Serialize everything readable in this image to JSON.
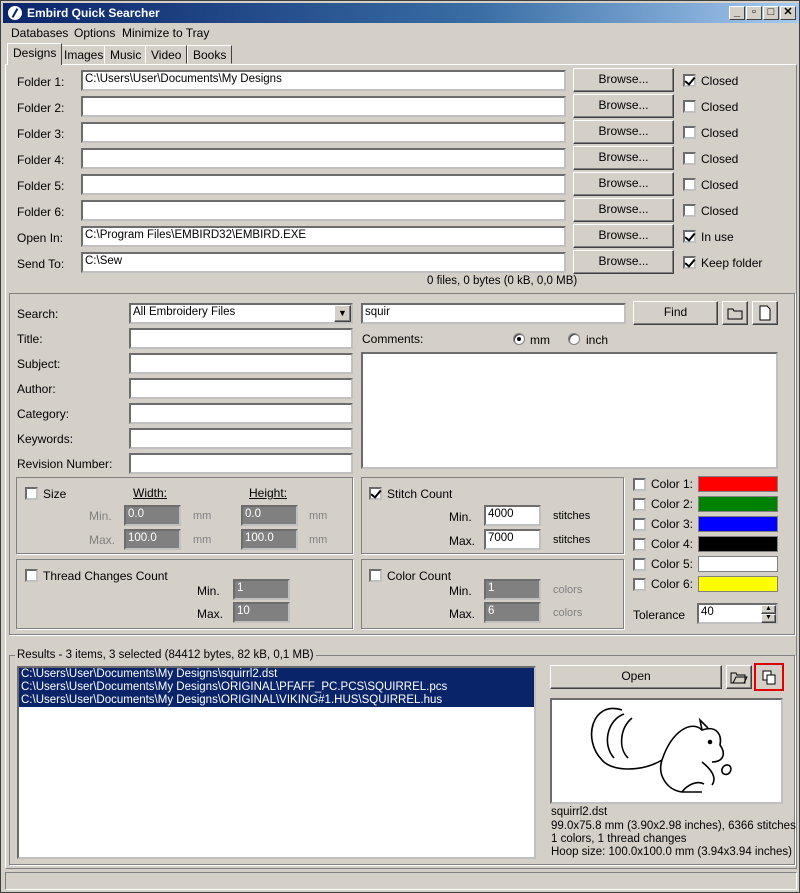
{
  "window": {
    "title": "Embird Quick Searcher"
  },
  "menu": [
    "Databases",
    "Options",
    "Minimize to Tray"
  ],
  "tabs": [
    "Designs",
    "Images",
    "Music",
    "Video",
    "Books"
  ],
  "folders": [
    {
      "label": "Folder 1:",
      "value": "C:\\Users\\User\\Documents\\My Designs",
      "browse": "Browse...",
      "check_label": "Closed",
      "checked": true
    },
    {
      "label": "Folder 2:",
      "value": "",
      "browse": "Browse...",
      "check_label": "Closed",
      "checked": false
    },
    {
      "label": "Folder 3:",
      "value": "",
      "browse": "Browse...",
      "check_label": "Closed",
      "checked": false
    },
    {
      "label": "Folder 4:",
      "value": "",
      "browse": "Browse...",
      "check_label": "Closed",
      "checked": false
    },
    {
      "label": "Folder 5:",
      "value": "",
      "browse": "Browse...",
      "check_label": "Closed",
      "checked": false
    },
    {
      "label": "Folder 6:",
      "value": "",
      "browse": "Browse...",
      "check_label": "Closed",
      "checked": false
    },
    {
      "label": "Open In:",
      "value": "C:\\Program Files\\EMBIRD32\\EMBIRD.EXE",
      "browse": "Browse...",
      "check_label": "In use",
      "checked": true
    },
    {
      "label": "Send To:",
      "value": "C:\\Sew",
      "browse": "Browse...",
      "check_label": "Keep folder",
      "checked": true
    }
  ],
  "folder_summary": "0 files, 0 bytes (0 kB, 0,0 MB)",
  "search": {
    "label": "Search:",
    "type_value": "All Embroidery Files",
    "query": "squir",
    "find": "Find",
    "fields": [
      {
        "label": "Title:",
        "value": ""
      },
      {
        "label": "Subject:",
        "value": ""
      },
      {
        "label": "Author:",
        "value": ""
      },
      {
        "label": "Category:",
        "value": ""
      },
      {
        "label": "Keywords:",
        "value": ""
      },
      {
        "label": "Revision Number:",
        "value": ""
      }
    ],
    "comments_label": "Comments:",
    "unit_mm": "mm",
    "unit_inch": "inch"
  },
  "size": {
    "label": "Size",
    "width": "Width:",
    "height": "Height:",
    "min": "Min.",
    "max": "Max.",
    "w_min": "0.0",
    "w_max": "100.0",
    "h_min": "0.0",
    "h_max": "100.0",
    "unit": "mm"
  },
  "stitch": {
    "label": "Stitch Count",
    "min": "Min.",
    "max": "Max.",
    "min_val": "4000",
    "max_val": "7000",
    "unit": "stitches"
  },
  "thread": {
    "label": "Thread Changes Count",
    "min": "Min.",
    "max": "Max.",
    "min_val": "1",
    "max_val": "10"
  },
  "colorcount": {
    "label": "Color Count",
    "min": "Min.",
    "max": "Max.",
    "min_val": "1",
    "max_val": "6",
    "unit": "colors"
  },
  "colors": [
    {
      "label": "Color 1:",
      "hex": "#ff0000"
    },
    {
      "label": "Color 2:",
      "hex": "#008000"
    },
    {
      "label": "Color 3:",
      "hex": "#0000ff"
    },
    {
      "label": "Color 4:",
      "hex": "#000000"
    },
    {
      "label": "Color 5:",
      "hex": "#ffffff"
    },
    {
      "label": "Color 6:",
      "hex": "#ffff00"
    }
  ],
  "tolerance": {
    "label": "Tolerance",
    "value": "40"
  },
  "results": {
    "title": "Results - 3 items, 3 selected (84412 bytes, 82 kB, 0,1 MB)",
    "items": [
      "C:\\Users\\User\\Documents\\My Designs\\squirrl2.dst",
      "C:\\Users\\User\\Documents\\My Designs\\ORIGINAL\\PFAFF_PC.PCS\\SQUIRREL.pcs",
      "C:\\Users\\User\\Documents\\My Designs\\ORIGINAL\\VIKING#1.HUS\\SQUIRREL.hus"
    ],
    "open": "Open"
  },
  "info": {
    "name": "squirrl2.dst",
    "dims": "99.0x75.8 mm (3.90x2.98 inches), 6366 stitches",
    "colors": "1 colors, 1 thread changes",
    "hoop": "Hoop size: 100.0x100.0 mm (3.94x3.94 inches)"
  }
}
